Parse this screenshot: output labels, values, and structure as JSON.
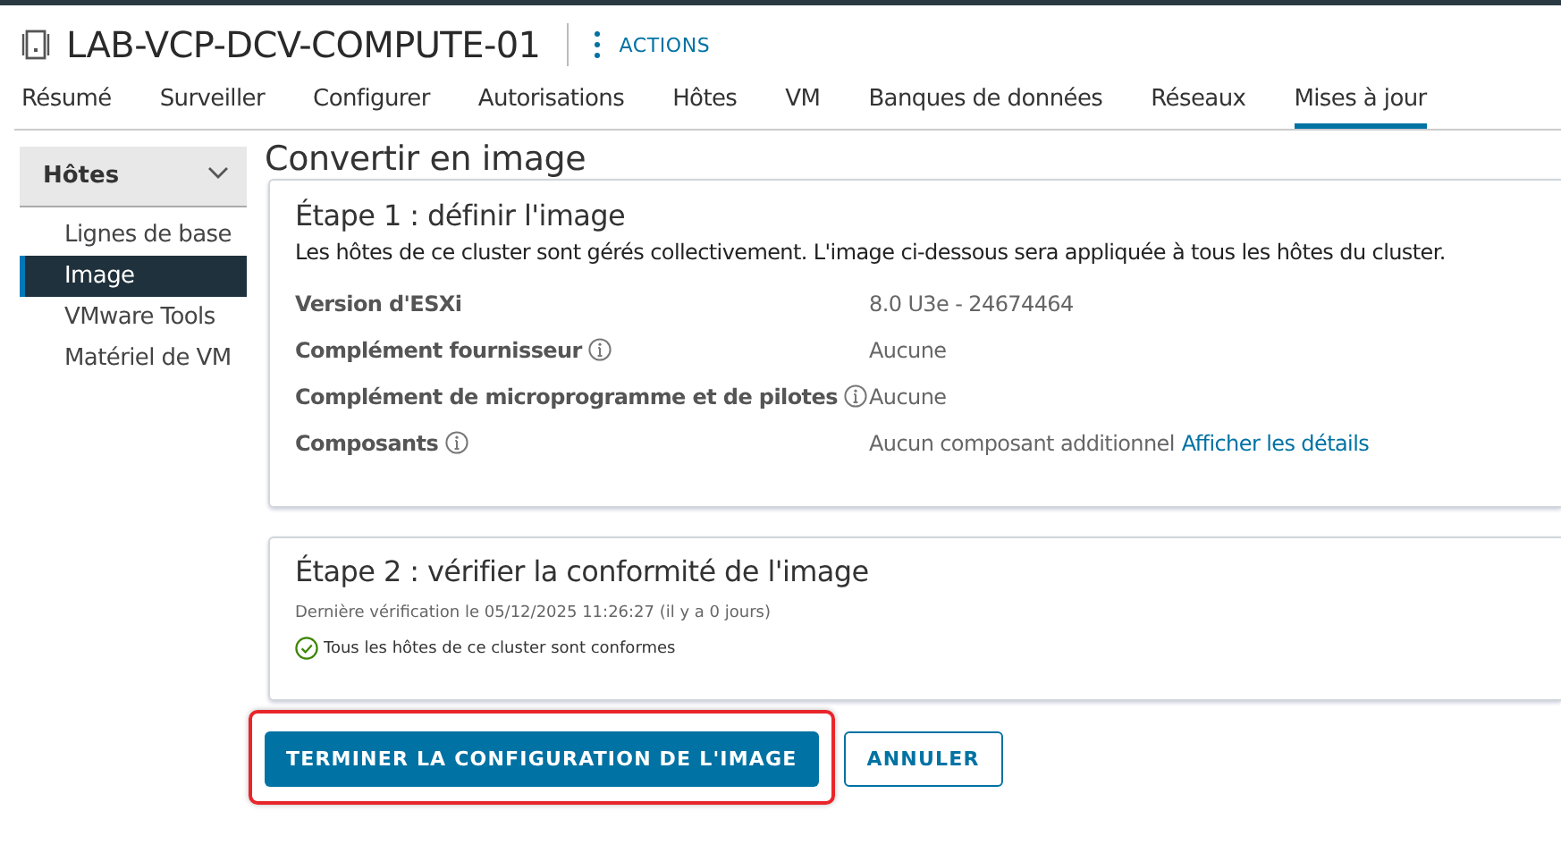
{
  "header": {
    "title": "LAB-VCP-DCV-COMPUTE-01",
    "actions": "ACTIONS"
  },
  "tabs": [
    {
      "label": "Résumé",
      "selected": false
    },
    {
      "label": "Surveiller",
      "selected": false
    },
    {
      "label": "Configurer",
      "selected": false
    },
    {
      "label": "Autorisations",
      "selected": false
    },
    {
      "label": "Hôtes",
      "selected": false
    },
    {
      "label": "VM",
      "selected": false
    },
    {
      "label": "Banques de données",
      "selected": false
    },
    {
      "label": "Réseaux",
      "selected": false
    },
    {
      "label": "Mises à jour",
      "selected": true
    }
  ],
  "sidebar": {
    "section": "Hôtes",
    "expanded": true,
    "items": [
      {
        "label": "Lignes de base",
        "selected": false
      },
      {
        "label": "Image",
        "selected": true
      },
      {
        "label": "VMware Tools",
        "selected": false
      },
      {
        "label": "Matériel de VM",
        "selected": false
      }
    ]
  },
  "page_title": "Convertir en image",
  "step1": {
    "title": "Étape 1 : définir l'image",
    "description": "Les hôtes de ce cluster sont gérés collectivement. L'image ci-dessous sera appliquée à tous les hôtes du cluster.",
    "fields": [
      {
        "label": "Version d'ESXi",
        "info": false,
        "value": "8.0 U3e - 24674464"
      },
      {
        "label": "Complément fournisseur",
        "info": true,
        "value": "Aucune"
      },
      {
        "label": "Complément de microprogramme et de pilotes",
        "info": true,
        "value": "Aucune"
      },
      {
        "label": "Composants",
        "info": true,
        "value": "Aucun composant additionnel",
        "link": "Afficher les détails"
      }
    ]
  },
  "step2": {
    "title": "Étape 2 : vérifier la conformité de l'image",
    "last_check": "Dernière vérification le 05/12/2025 11:26:27 (il y a 0 jours)",
    "status": "Tous les hôtes de ce cluster sont conformes",
    "compliant": true
  },
  "buttons": [
    {
      "label": "TERMINER LA CONFIGURATION DE L'IMAGE",
      "kind": "primary",
      "highlighted": true
    },
    {
      "label": "ANNULER",
      "kind": "outline",
      "highlighted": false
    }
  ]
}
